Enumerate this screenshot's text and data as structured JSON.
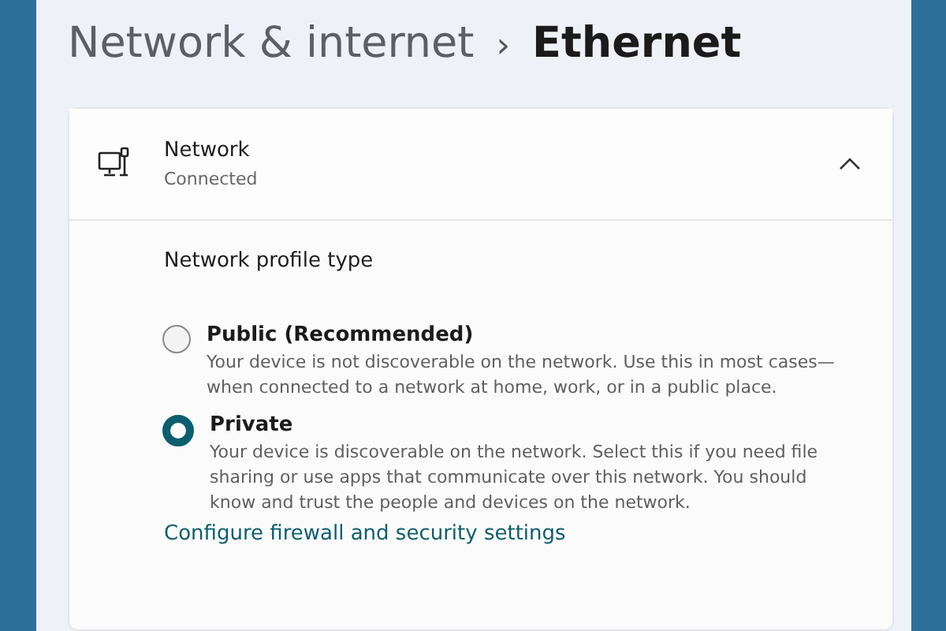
{
  "breadcrumb": {
    "parent": "Network & internet",
    "separator": "›",
    "current": "Ethernet"
  },
  "network": {
    "name": "Network",
    "status": "Connected",
    "expanded": true
  },
  "profile": {
    "heading": "Network profile type",
    "options": [
      {
        "label": "Public (Recommended)",
        "description": "Your device is not discoverable on the network. Use this in most cases—when connected to a network at home, work, or in a public place.",
        "selected": false
      },
      {
        "label": "Private",
        "description": "Your device is discoverable on the network. Select this if you need file sharing or use apps that communicate over this network. You should know and trust the people and devices on the network.",
        "selected": true
      }
    ]
  },
  "link": "Configure firewall and security settings"
}
